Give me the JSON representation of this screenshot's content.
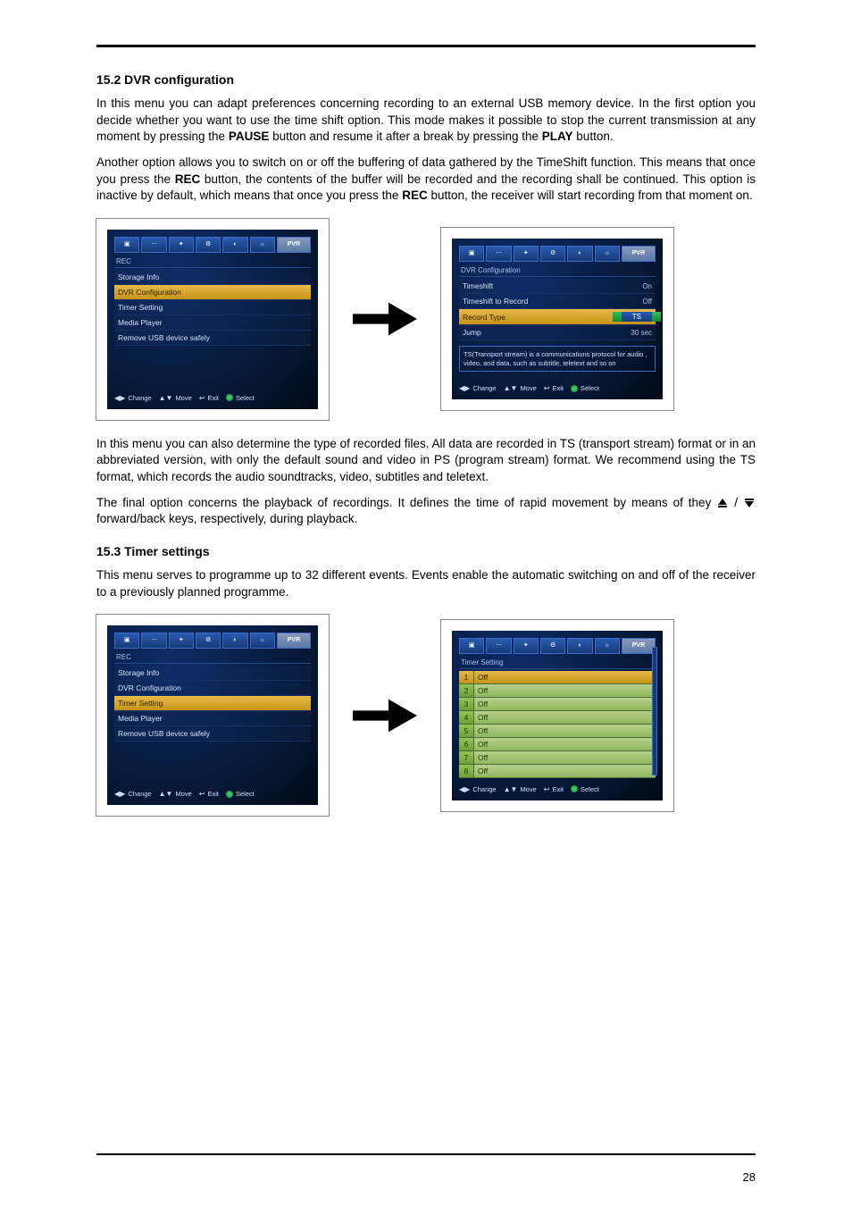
{
  "page_number": "28",
  "section_15_2": {
    "heading": "15.2 DVR configuration",
    "p1a": "In this menu you can adapt preferences concerning recording to an external USB memory device. In the first option you decide whether you want to use the time shift option. This mode makes it possible to stop the current transmission at any moment by pressing the ",
    "p1_b1": "PAUSE",
    "p1b": " button and resume it after a break by pressing the ",
    "p1_b2": "PLAY",
    "p1c": " button.",
    "p2a": "Another option allows you to switch on or off the buffering of data gathered by the TimeShift function. This means that once you press the ",
    "p2_b1": "REC",
    "p2b": " button, the contents of the buffer will be recorded and the recording shall be continued. This option is inactive by default, which means that once you press the ",
    "p2_b2": "REC",
    "p2c": " button, the receiver will start recording from that moment on.",
    "p3": "In this menu you can also determine the type of recorded files. All data are recorded in TS (transport stream) format or in an abbreviated version, with only the default sound and video in PS (program stream) format. We recommend using the TS format, which records the audio soundtracks, video, subtitles and teletext.",
    "p4a": "The final option concerns the playback of recordings. It defines the time of rapid movement by means of they ",
    "p4b": " / ",
    "p4c": " forward/back keys, respectively, during playback."
  },
  "section_15_3": {
    "heading": "15.3 Timer settings",
    "p1": "This menu serves to programme up to 32 different events. Events enable the automatic switching on and off of the receiver to a previously planned programme."
  },
  "panels": {
    "common": {
      "pvr_tab": "PVR",
      "footer": {
        "change": "Change",
        "move": "Move",
        "exit": "Exit",
        "select": "Select"
      }
    },
    "rec_menu": {
      "title": "REC",
      "items": [
        "Storage Info",
        "DVR Configuration",
        "Timer Setting",
        "Media Player",
        "Remove USB device safely"
      ]
    },
    "dvr_config": {
      "title": "DVR Configuration",
      "rows": {
        "timeshift": {
          "label": "Timeshift",
          "value": "On"
        },
        "ts2rec": {
          "label": "Timeshift to Record",
          "value": "Off"
        },
        "rectype": {
          "label": "Record Type",
          "value": "TS"
        },
        "jump": {
          "label": "Jump",
          "value": "30 sec"
        }
      },
      "desc": "TS(Transport stream) is a communications protocol for audio , video, and data, such as subtitle, teletext and so on"
    },
    "timer_setting": {
      "title": "Timer Setting",
      "rows": [
        {
          "idx": "1",
          "state": "Off"
        },
        {
          "idx": "2",
          "state": "Off"
        },
        {
          "idx": "3",
          "state": "Off"
        },
        {
          "idx": "4",
          "state": "Off"
        },
        {
          "idx": "5",
          "state": "Off"
        },
        {
          "idx": "6",
          "state": "Off"
        },
        {
          "idx": "7",
          "state": "Off"
        },
        {
          "idx": "8",
          "state": "Off"
        }
      ]
    }
  }
}
